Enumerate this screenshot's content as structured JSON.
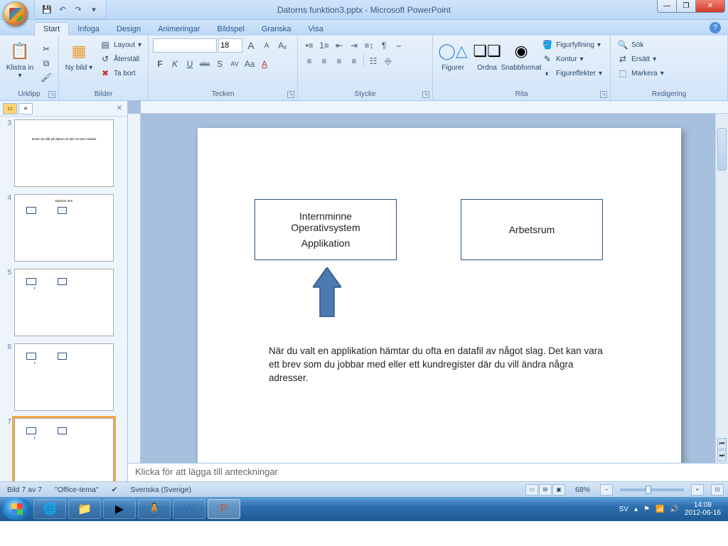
{
  "title": "Datorns funktion3.pptx - Microsoft PowerPoint",
  "qat": {
    "save": "💾",
    "undo": "↶",
    "redo": "↷",
    "more": "▾"
  },
  "win": {
    "min": "—",
    "max": "❐",
    "close": "✕"
  },
  "tabs": [
    "Start",
    "Infoga",
    "Design",
    "Animeringar",
    "Bildspel",
    "Granska",
    "Visa"
  ],
  "ribbon": {
    "clipboard": {
      "label": "Urklipp",
      "paste": "Klistra in",
      "paste_more": "▾"
    },
    "slides": {
      "label": "Bilder",
      "new": "Ny bild",
      "new_more": "▾",
      "layout": "Layout",
      "reset": "Återställ",
      "delete": "Ta bort"
    },
    "font": {
      "label": "Tecken",
      "name": "",
      "size": "18",
      "grow": "A",
      "shrink": "A",
      "clear": "Aₓ",
      "bold": "F",
      "italic": "K",
      "underline": "U",
      "strike": "abc",
      "shadow": "S",
      "spacing": "AV",
      "case": "Aa",
      "color": "A"
    },
    "para": {
      "label": "Stycke",
      "bullets": "•≡",
      "numbers": "1≡",
      "indent_out": "⇤",
      "indent_in": "⇥",
      "linesp": "≡↕",
      "dir": "¶",
      "left": "≡",
      "center": "≡",
      "right": "≡",
      "just": "≡",
      "cols": "☷",
      "align": "⎯",
      "smart": "⎆"
    },
    "draw": {
      "label": "Rita",
      "shapes": "Figurer",
      "arrange": "Ordna",
      "quick": "Snabbformat",
      "fill": "Figurfyllning",
      "outline": "Kontur",
      "effects": "Figureffekter"
    },
    "edit": {
      "label": "Redigering",
      "find": "Sök",
      "replace": "Ersätt",
      "select": "Markera"
    }
  },
  "panel": {
    "close": "✕"
  },
  "thumbs": [
    {
      "num": "3",
      "title": "Innan du slår på datorn är den en tom maskin"
    },
    {
      "num": "4",
      "title": "Datorns inre"
    },
    {
      "num": "5",
      "title": ""
    },
    {
      "num": "6",
      "title": ""
    },
    {
      "num": "7",
      "title": ""
    }
  ],
  "slide": {
    "box1_l1": "Internminne",
    "box1_l2": "Operativsystem",
    "box1_l3": "Applikation",
    "box2": "Arbetsrum",
    "para": "När du valt en applikation hämtar du ofta en datafil av något slag. Det kan vara ett brev som du jobbar med eller ett kundregister där du vill ändra några adresser."
  },
  "notes_placeholder": "Klicka för att lägga till anteckningar",
  "status": {
    "slide": "Bild 7 av 7",
    "theme": "\"Office-tema\"",
    "lang": "Svenska (Sverige)",
    "zoom": "68%"
  },
  "tray": {
    "lang": "SV",
    "time": "14:08",
    "date": "2012-06-16"
  }
}
